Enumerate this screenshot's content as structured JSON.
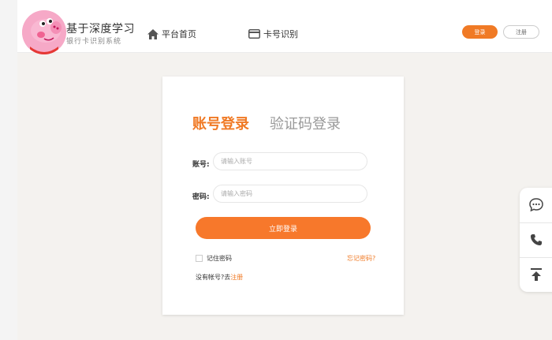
{
  "header": {
    "brand_title": "基于深度学习",
    "brand_subtitle": "银行卡识别系统",
    "logo_icon": "peppa-pig-avatar-icon",
    "nav": [
      {
        "label": "平台首页",
        "icon": "home-icon"
      },
      {
        "label": "卡号识别",
        "icon": "credit-card-icon"
      }
    ],
    "login_label": "登录",
    "register_label": "注册"
  },
  "login": {
    "tab_account": "账号登录",
    "tab_code": "验证码登录",
    "account_label": "账号:",
    "account_placeholder": "请输入账号",
    "password_label": "密码:",
    "password_placeholder": "请输入密码",
    "submit_label": "立即登录",
    "remember_label": "记住密码",
    "forgot_label": "忘记密码?",
    "no_account_text": "没有帐号?去",
    "register_link": "注册"
  },
  "side_tools": [
    {
      "icon": "chat-bubble-icon"
    },
    {
      "icon": "phone-icon"
    },
    {
      "icon": "back-to-top-icon"
    }
  ],
  "colors": {
    "accent": "#f07a25",
    "background": "#f4f2ef",
    "muted_text": "#999999"
  }
}
